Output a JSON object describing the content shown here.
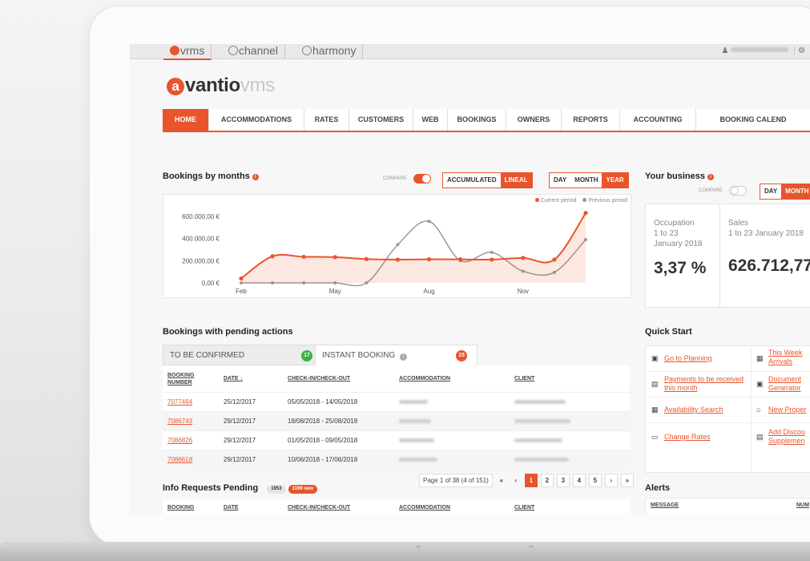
{
  "apps": [
    {
      "name": "vrms",
      "active": true
    },
    {
      "name": "channel",
      "active": false
    },
    {
      "name": "harmony",
      "active": false
    }
  ],
  "logo": {
    "main": "vantio",
    "suffix": "vms",
    "mark": "a"
  },
  "nav": [
    "HOME",
    "ACCOMMODATIONS",
    "RATES",
    "CUSTOMERS",
    "WEB",
    "BOOKINGS",
    "OWNERS",
    "REPORTS",
    "ACCOUNTING",
    "BOOKING CALEND"
  ],
  "bookings": {
    "title": "Bookings by months",
    "compare": "COMPARE",
    "mode": [
      "ACCUMULATED",
      "LINEAL"
    ],
    "mode_selected": "LINEAL",
    "period": [
      "DAY",
      "MONTH",
      "YEAR"
    ],
    "period_selected": "YEAR",
    "legend_current": "Current period",
    "legend_previous": "Previous period"
  },
  "chart_data": {
    "type": "area",
    "x": [
      "Feb",
      "Mar",
      "Apr",
      "May",
      "Jun",
      "Jul",
      "Aug",
      "Sep",
      "Oct",
      "Nov",
      "Dec",
      "Jan"
    ],
    "tick_labels_x": [
      "Feb",
      "May",
      "Aug",
      "Nov"
    ],
    "tick_labels_y": [
      "600.000,00 €",
      "400.000,00 €",
      "200.000,00 €",
      "0,00 €"
    ],
    "ylim": [
      0,
      650000
    ],
    "series": [
      {
        "name": "Current period",
        "color": "#e8552c",
        "values": [
          40000,
          240000,
          235000,
          232000,
          215000,
          210000,
          213000,
          212000,
          210000,
          225000,
          210000,
          630000
        ]
      },
      {
        "name": "Previous period",
        "color": "#999999",
        "values": [
          0,
          0,
          0,
          0,
          0,
          345000,
          555000,
          200000,
          275000,
          105000,
          95000,
          390000
        ]
      }
    ],
    "grid": false,
    "legend": "top-right"
  },
  "business": {
    "title": "Your business",
    "compare": "COMPARE",
    "period": [
      "DAY",
      "MONTH"
    ],
    "period_selected": "MONTH",
    "occupation_label": "Occupation",
    "occupation_range": "1 to 23",
    "occupation_month": "January 2018",
    "occupation_value": "3,37 %",
    "sales_label": "Sales",
    "sales_range": "1 to 23 January 2018",
    "sales_value": "626.712,77"
  },
  "pending": {
    "title": "Bookings with pending actions",
    "tab1": "TO BE CONFIRMED",
    "tab1_count": "17",
    "tab2": "INSTANT BOOKING",
    "tab2_count": "15",
    "columns": [
      "BOOKING NUMBER",
      "DATE",
      "CHECK-IN/CHECK-OUT",
      "ACCOMMODATION",
      "CLIENT"
    ],
    "rows": [
      {
        "number": "7077464",
        "date": "25/12/2017",
        "range": "05/05/2018 - 14/05/2018"
      },
      {
        "number": "7086743",
        "date": "29/12/2017",
        "range": "18/08/2018 - 25/08/2018"
      },
      {
        "number": "7086826",
        "date": "29/12/2017",
        "range": "01/05/2018 - 09/05/2018"
      },
      {
        "number": "7086618",
        "date": "29/12/2017",
        "range": "10/06/2018 - 17/06/2018"
      }
    ],
    "page_info": "Page 1 of 38 (4 of 151)",
    "pages": [
      "1",
      "2",
      "3",
      "4",
      "5"
    ]
  },
  "info_requests": {
    "title": "Info Requests Pending",
    "count": "1953",
    "new_count": "1199 new",
    "columns": [
      "BOOKING",
      "DATE",
      "CHECK-IN/CHECK-OUT",
      "ACCOMMODATION",
      "CLIENT"
    ]
  },
  "quick_start": {
    "title": "Quick Start",
    "left": [
      "Go to Planning",
      "Payments to be received this month",
      "Availability Search",
      "Change Rates"
    ],
    "right": [
      "This Week Arrivals",
      "Document Generator",
      "New Proper",
      "Add Discou Supplemen"
    ]
  },
  "alerts": {
    "title": "Alerts",
    "col1": "MESSAGE",
    "col2": "NUM"
  },
  "colors": {
    "accent": "#e8552c"
  }
}
